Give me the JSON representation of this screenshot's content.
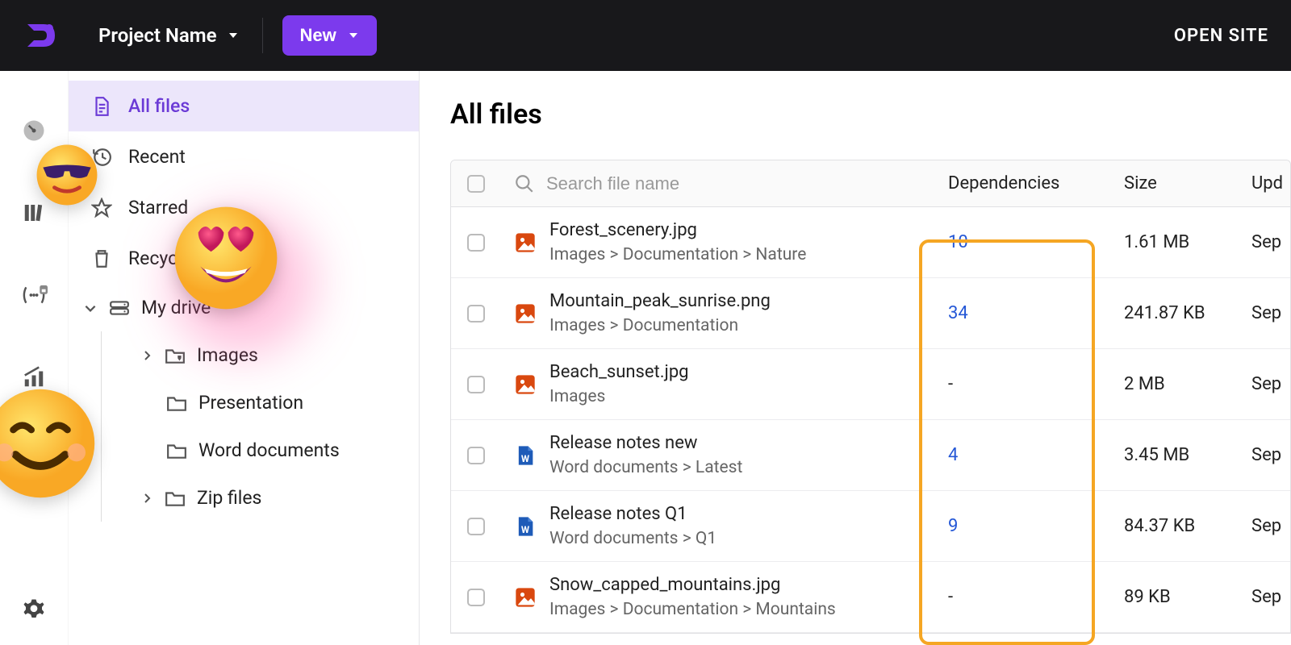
{
  "header": {
    "project_label": "Project Name",
    "new_label": "New",
    "open_site_label": "OPEN SITE"
  },
  "sidebar": {
    "nav": {
      "all_files": "All files",
      "recent": "Recent",
      "starred": "Starred",
      "recycle": "Recycle",
      "my_drive": "My drive"
    },
    "tree": {
      "images": "Images",
      "presentation": "Presentation",
      "word_documents": "Word documents",
      "zip_files": "Zip files"
    }
  },
  "page": {
    "title": "All files"
  },
  "table": {
    "headers": {
      "search_placeholder": "Search file name",
      "dependencies": "Dependencies",
      "size": "Size",
      "updated": "Upd"
    },
    "rows": [
      {
        "name": "Forest_scenery.jpg",
        "path": "Images > Documentation > Nature",
        "deps": "10",
        "deps_link": true,
        "size": "1.61 MB",
        "updated": "Sep",
        "type": "img"
      },
      {
        "name": "Mountain_peak_sunrise.png",
        "path": "Images > Documentation",
        "deps": "34",
        "deps_link": true,
        "size": "241.87 KB",
        "updated": "Sep",
        "type": "img"
      },
      {
        "name": "Beach_sunset.jpg",
        "path": "Images",
        "deps": "-",
        "deps_link": false,
        "size": "2 MB",
        "updated": "Sep",
        "type": "img"
      },
      {
        "name": "Release notes new",
        "path": "Word documents > Latest",
        "deps": "4",
        "deps_link": true,
        "size": "3.45 MB",
        "updated": "Sep",
        "type": "doc"
      },
      {
        "name": "Release notes Q1",
        "path": "Word documents > Q1",
        "deps": "9",
        "deps_link": true,
        "size": "84.37 KB",
        "updated": "Sep",
        "type": "doc"
      },
      {
        "name": "Snow_capped_mountains.jpg",
        "path": "Images > Documentation > Mountains",
        "deps": "-",
        "deps_link": false,
        "size": "89 KB",
        "updated": "Sep",
        "type": "img"
      }
    ]
  }
}
